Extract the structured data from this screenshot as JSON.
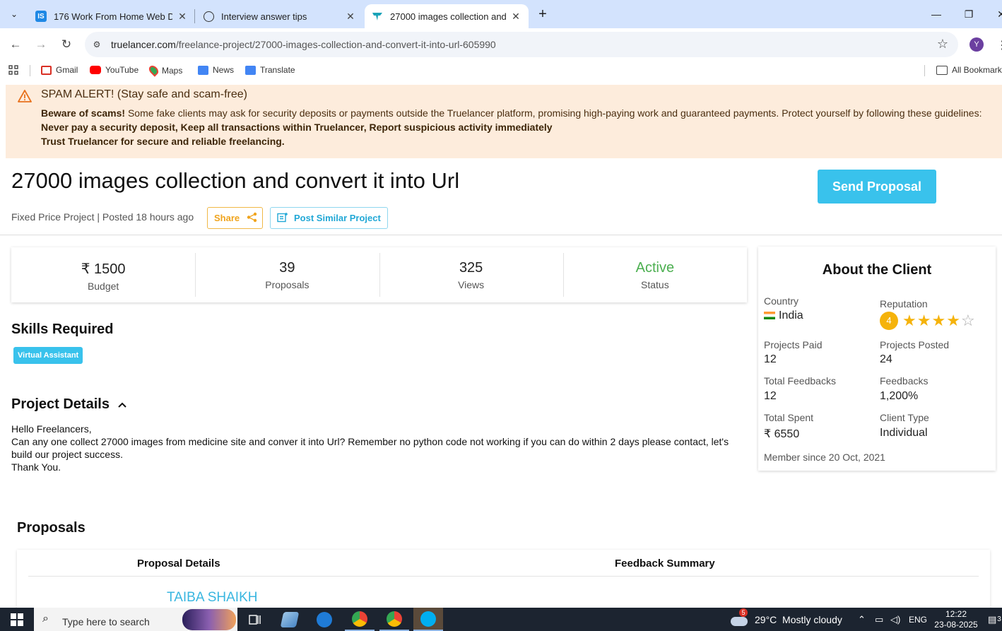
{
  "browser": {
    "tabs": [
      {
        "title": "176 Work From Home Web Dev",
        "favicon": "IS",
        "color": "#1e88e5"
      },
      {
        "title": "Interview answer tips",
        "favicon": "chatgpt-icon"
      },
      {
        "title": "27000 images collection and co",
        "favicon": "truelancer-icon",
        "active": true
      }
    ],
    "url_host": "truelancer.com",
    "url_path": "/freelance-project/27000-images-collection-and-convert-it-into-url-605990",
    "profile_initial": "Y",
    "bookmarks": [
      "Gmail",
      "YouTube",
      "Maps",
      "News",
      "Translate"
    ],
    "all_bookmarks": "All Bookmarks"
  },
  "alert": {
    "title": "SPAM ALERT! (Stay safe and scam-free)",
    "beware": "Beware of scams!",
    "text": " Some fake clients may ask for security deposits or payments outside the Truelancer platform, promising high-paying work and guaranteed payments. Protect yourself by following these guidelines: ",
    "rules": "Never pay a security deposit, Keep all transactions within Truelancer, Report suspicious activity immediately",
    "trust": "Trust Truelancer for secure and reliable freelancing."
  },
  "project": {
    "title": "27000 images collection and convert it into Url",
    "meta": "Fixed Price Project | Posted 18 hours ago",
    "share": "Share",
    "post_similar": "Post Similar Project",
    "send_proposal": "Send Proposal"
  },
  "stats": [
    {
      "value": "₹ 1500",
      "label": "Budget"
    },
    {
      "value": "39",
      "label": "Proposals"
    },
    {
      "value": "325",
      "label": "Views"
    },
    {
      "value": "Active",
      "label": "Status"
    }
  ],
  "client": {
    "heading": "About the Client",
    "country_label": "Country",
    "country": "India",
    "reputation_label": "Reputation",
    "reputation": "4",
    "stars_filled": 4,
    "stars_total": 5,
    "projects_paid_label": "Projects Paid",
    "projects_paid": "12",
    "projects_posted_label": "Projects Posted",
    "projects_posted": "24",
    "total_feedbacks_label": "Total Feedbacks",
    "total_feedbacks": "12",
    "feedbacks_label": "Feedbacks",
    "feedbacks": "1,200%",
    "total_spent_label": "Total Spent",
    "total_spent": "₹ 6550",
    "client_type_label": "Client Type",
    "client_type": "Individual",
    "member_since": "Member since 20 Oct, 2021"
  },
  "skills": {
    "heading": "Skills Required",
    "items": [
      "Virtual Assistant"
    ]
  },
  "details": {
    "heading": "Project Details",
    "line1": "Hello Freelancers,",
    "line2": "Can any one collect 27000 images from medicine site and conver it into Url? Remember no python code not working if you can do within 2 days please contact, let's build our project success.",
    "line3": "Thank You."
  },
  "proposals": {
    "heading": "Proposals",
    "col1": "Proposal Details",
    "col2": "Feedback Summary",
    "first_name": "TAIBA SHAIKH"
  },
  "taskbar": {
    "search_placeholder": "Type here to search",
    "weather_badge": "5",
    "weather": "29°C  Mostly cloudy",
    "lang": "ENG",
    "time": "12:22",
    "date": "23-08-2025",
    "notif": "3"
  },
  "colors": {
    "accent": "#39c2ec",
    "alert_bg": "#fdecdc",
    "active_green": "#4caf50",
    "star": "#f5b30b"
  }
}
